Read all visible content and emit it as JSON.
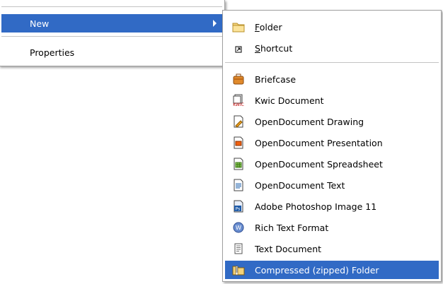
{
  "context_menu": {
    "new_label": "New",
    "properties_label": "Properties"
  },
  "new_submenu": {
    "folder": {
      "accel": "F",
      "rest": "older",
      "icon": "folder-icon"
    },
    "shortcut": {
      "accel": "S",
      "rest": "hortcut",
      "icon": "shortcut-icon"
    },
    "items": [
      {
        "label": "Briefcase",
        "icon": "briefcase-icon"
      },
      {
        "label": "Kwic Document",
        "icon": "kwic-document-icon"
      },
      {
        "label": "OpenDocument Drawing",
        "icon": "opendocument-drawing-icon"
      },
      {
        "label": "OpenDocument Presentation",
        "icon": "opendocument-presentation-icon"
      },
      {
        "label": "OpenDocument Spreadsheet",
        "icon": "opendocument-spreadsheet-icon"
      },
      {
        "label": "OpenDocument Text",
        "icon": "opendocument-text-icon"
      },
      {
        "label": "Adobe Photoshop Image 11",
        "icon": "photoshop-image-icon"
      },
      {
        "label": "Rich Text Format",
        "icon": "rich-text-format-icon"
      },
      {
        "label": "Text Document",
        "icon": "text-document-icon"
      },
      {
        "label": "Compressed (zipped) Folder",
        "icon": "zip-folder-icon"
      }
    ]
  },
  "colors": {
    "highlight": "#316ac5",
    "separator": "#c4c4c4"
  }
}
